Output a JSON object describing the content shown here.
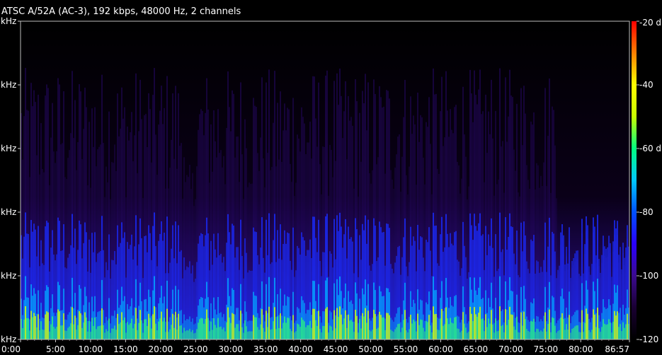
{
  "header": {
    "format_info": "ATSC A/52A (AC-3), 192 kbps, 48000 Hz, 2 channels"
  },
  "chart_data": {
    "type": "heatmap",
    "title": "",
    "x_axis": {
      "unit": "minutes",
      "range": [
        0,
        86.95
      ],
      "tick_values": [
        0,
        5,
        10,
        15,
        20,
        25,
        30,
        35,
        40,
        45,
        50,
        55,
        60,
        65,
        70,
        75,
        80,
        86.95
      ],
      "tick_labels": [
        "0:00",
        "5:00",
        "10:00",
        "15:00",
        "20:00",
        "25:00",
        "30:00",
        "35:00",
        "40:00",
        "45:00",
        "50:00",
        "55:00",
        "60:00",
        "65:00",
        "70:00",
        "75:00",
        "80:00",
        "86:57"
      ]
    },
    "y_axis": {
      "tick_labels": [
        "kHz",
        "kHz",
        "kHz",
        "kHz",
        "kHz",
        "kHz"
      ]
    },
    "colorbar": {
      "tick_labels": [
        "-20 d",
        "-40",
        "-60 d",
        "-80",
        "-100",
        "-120"
      ],
      "tick_values": [
        -20,
        -40,
        -60,
        -80,
        -100,
        -120
      ],
      "range": [
        -120,
        -20
      ],
      "stops": [
        "#000000",
        "#1a0033",
        "#3b0a8f",
        "#2a00ff",
        "#0050ff",
        "#00c8ff",
        "#00ff80",
        "#c8ff00",
        "#ffff00",
        "#ff8000",
        "#ff0000"
      ]
    },
    "grid": false,
    "colorbar_position": "right"
  }
}
